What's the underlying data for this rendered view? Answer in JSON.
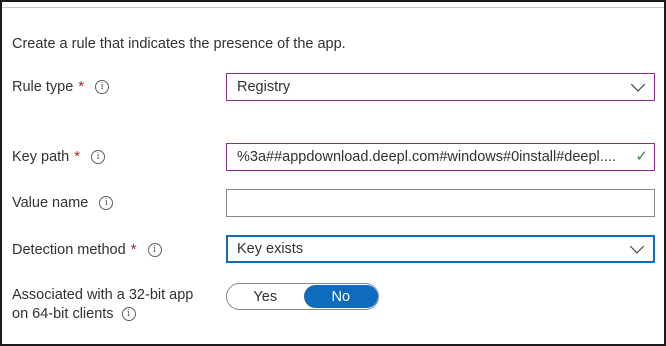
{
  "heading": "Create a rule that indicates the presence of the app.",
  "required_marker": "*",
  "info_glyph": "i",
  "rule_type": {
    "label": "Rule type",
    "value": "Registry"
  },
  "key_path": {
    "label": "Key path",
    "value": "%3a##appdownload.deepl.com#windows#0install#deepl....",
    "valid_mark": "✓"
  },
  "value_name": {
    "label": "Value name",
    "value": ""
  },
  "detection_method": {
    "label": "Detection method",
    "value": "Key exists"
  },
  "associated": {
    "label_line1": "Associated with a 32-bit app",
    "label_line2": "on 64-bit clients",
    "yes": "Yes",
    "no": "No",
    "selected": "No"
  },
  "colors": {
    "accent": "#0f6cbd",
    "required": "#a4262c",
    "focus_purple": "#8a2d8b",
    "valid_green": "#2e8b3a"
  }
}
